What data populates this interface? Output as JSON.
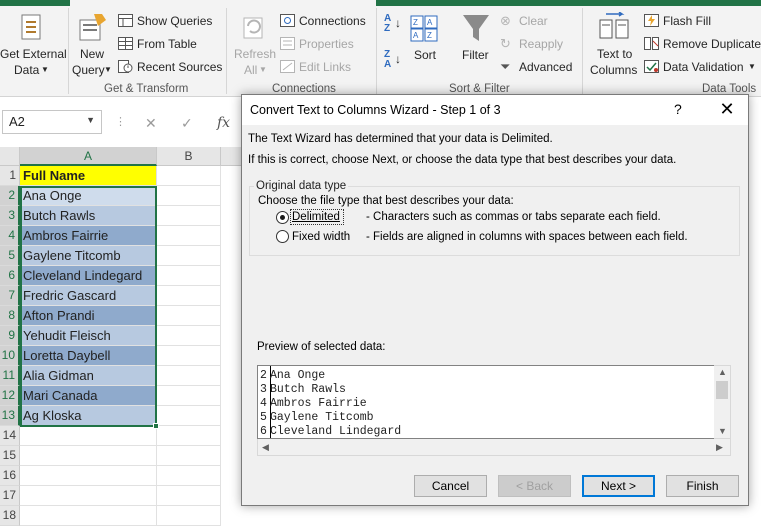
{
  "ribbon": {
    "get_external_line1": "Get External",
    "get_external_line2": "Data",
    "new_query_line1": "New",
    "new_query_line2": "Query",
    "show_queries": "Show Queries",
    "from_table": "From Table",
    "recent_sources": "Recent Sources",
    "group_get_transform": "Get & Transform",
    "refresh_all_line1": "Refresh",
    "refresh_all_line2": "All",
    "connections": "Connections",
    "properties": "Properties",
    "edit_links": "Edit Links",
    "group_connections": "Connections",
    "sort": "Sort",
    "filter": "Filter",
    "clear": "Clear",
    "reapply": "Reapply",
    "advanced": "Advanced",
    "group_sort_filter": "Sort & Filter",
    "text_to_columns_line1": "Text to",
    "text_to_columns_line2": "Columns",
    "flash_fill": "Flash Fill",
    "remove_duplicates": "Remove Duplicates",
    "data_validation": "Data Validation",
    "group_data_tools": "Data Tools",
    "accent_color": "#217346"
  },
  "formula_bar": {
    "name_box": "A2",
    "cancel_symbol": "✕",
    "enter_symbol": "✓",
    "fx_symbol": "fx"
  },
  "sheet": {
    "columns": [
      "A",
      "B"
    ],
    "rows": [
      "1",
      "2",
      "3",
      "4",
      "5",
      "6",
      "7",
      "8",
      "9",
      "10",
      "11",
      "12",
      "13",
      "14",
      "15",
      "16",
      "17",
      "18"
    ],
    "cells_a": [
      "Full Name",
      "Ana Onge",
      "Butch Rawls",
      "Ambros Fairrie",
      "Gaylene Titcomb",
      "Cleveland Lindegard",
      "Fredric Gascard",
      "Afton Prandi",
      "Yehudit Fleisch",
      "Loretta Daybell",
      "Alia Gidman",
      "Mari Canada",
      "Ag Kloska"
    ]
  },
  "dialog": {
    "title": "Convert Text to Columns Wizard - Step 1 of 3",
    "help": "?",
    "close": "✕",
    "intro1": "The Text Wizard has determined that your data is Delimited.",
    "intro2": "If this is correct, choose Next, or choose the data type that best describes your data.",
    "group_label": "Original data type",
    "choose_label": "Choose the file type that best describes your data:",
    "delimited_label": "Delimited",
    "delimited_desc": "- Characters such as commas or tabs separate each field.",
    "fixed_label": "Fixed width",
    "fixed_desc": "- Fields are aligned in columns with spaces between each field.",
    "preview_label": "Preview of selected data:",
    "preview_lines": [
      {
        "num": "2",
        "text": "Ana Onge"
      },
      {
        "num": "3",
        "text": "Butch Rawls"
      },
      {
        "num": "4",
        "text": "Ambros Fairrie"
      },
      {
        "num": "5",
        "text": "Gaylene Titcomb"
      },
      {
        "num": "6",
        "text": "Cleveland Lindegard"
      }
    ],
    "cancel_btn": "Cancel",
    "back_btn": "< Back",
    "next_btn": "Next >",
    "finish_btn": "Finish"
  }
}
